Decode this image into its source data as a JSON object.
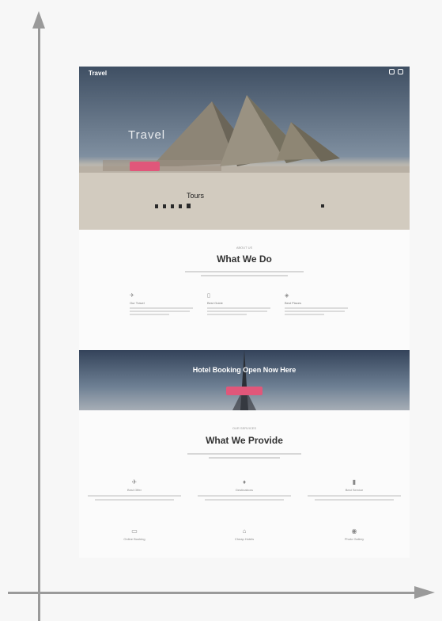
{
  "hero": {
    "brand": "Travel",
    "title": "Travel",
    "subtitle": "Tours",
    "icons": [
      "search-icon",
      "menu-icon"
    ]
  },
  "what_we_do": {
    "eyebrow": "ABOUT US",
    "title": "What We Do",
    "features": [
      {
        "icon": "map-icon",
        "glyph": "✈",
        "title": "Our Travel"
      },
      {
        "icon": "document-icon",
        "glyph": "▯",
        "title": "Best Guide"
      },
      {
        "icon": "globe-icon",
        "glyph": "◈",
        "title": "Best Places"
      }
    ]
  },
  "banner": {
    "title": "Hotel Booking Open Now Here"
  },
  "what_we_provide": {
    "eyebrow": "OUR SERVICES",
    "title": "What We Provide",
    "services": [
      {
        "icon": "plane-icon",
        "glyph": "✈",
        "title": "Best Offer"
      },
      {
        "icon": "pin-icon",
        "glyph": "♦",
        "title": "Destinations"
      },
      {
        "icon": "suitcase-icon",
        "glyph": "▮",
        "title": "Best Service"
      },
      {
        "icon": "monitor-icon",
        "glyph": "▭",
        "title": "Online Booking"
      },
      {
        "icon": "hotel-icon",
        "glyph": "⌂",
        "title": "Cheap Hotels"
      },
      {
        "icon": "camera-icon",
        "glyph": "◉",
        "title": "Photo Gallery"
      }
    ]
  },
  "colors": {
    "accent": "#e0577a",
    "axis": "#9a9a9a"
  }
}
